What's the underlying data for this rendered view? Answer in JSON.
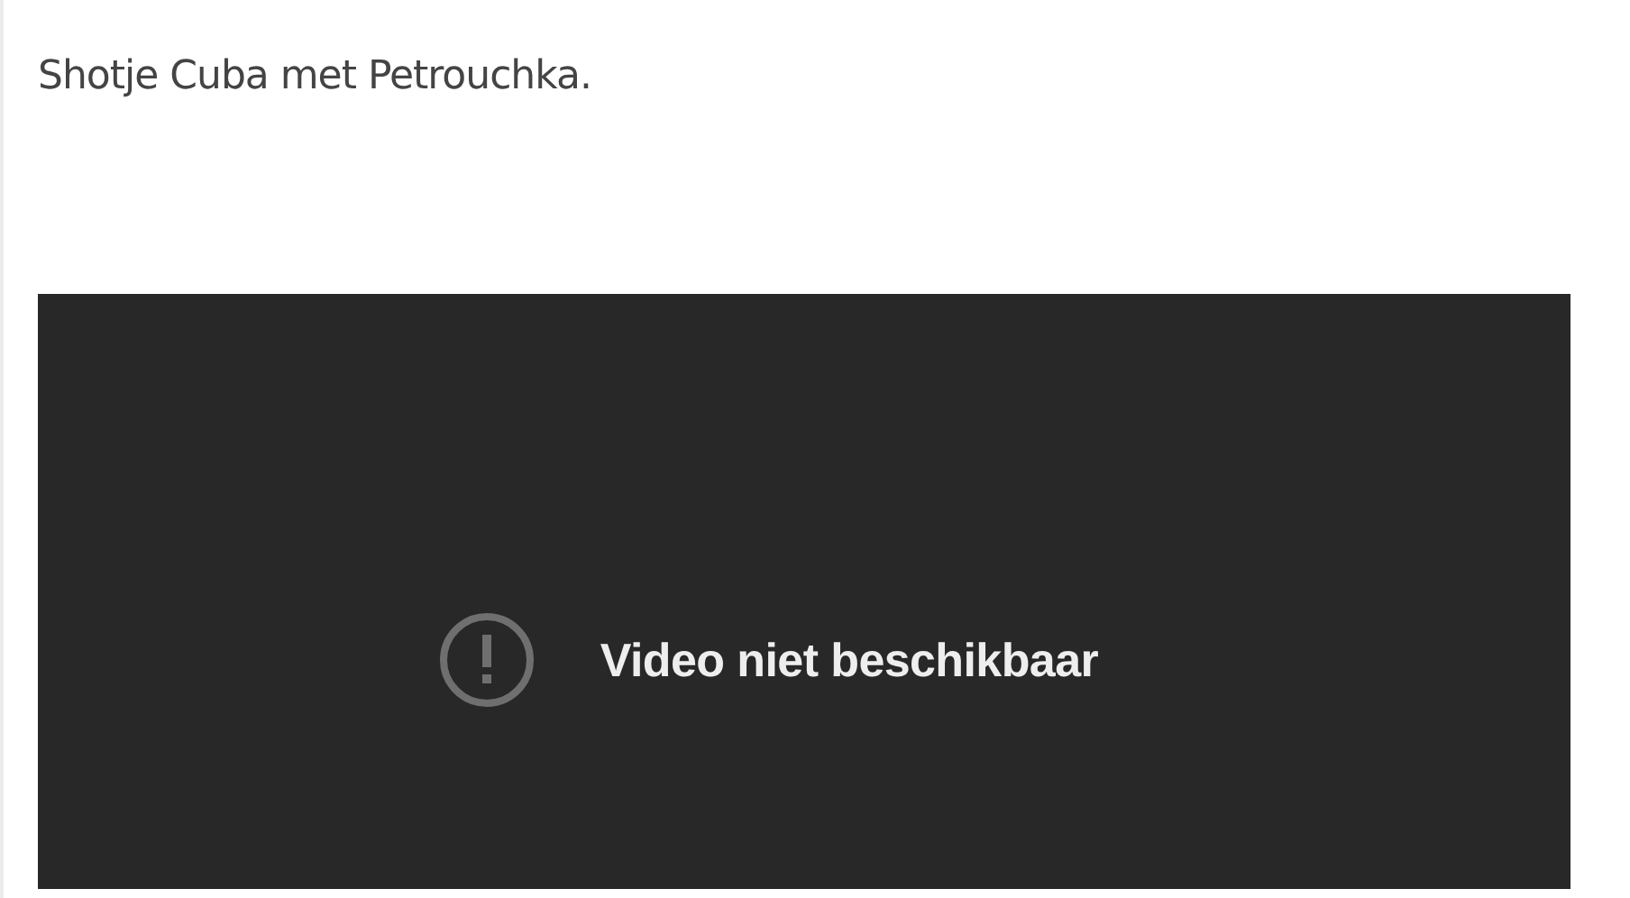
{
  "post": {
    "text": "Shotje Cuba met Petrouchka."
  },
  "video": {
    "message": "Video niet beschikbaar"
  }
}
